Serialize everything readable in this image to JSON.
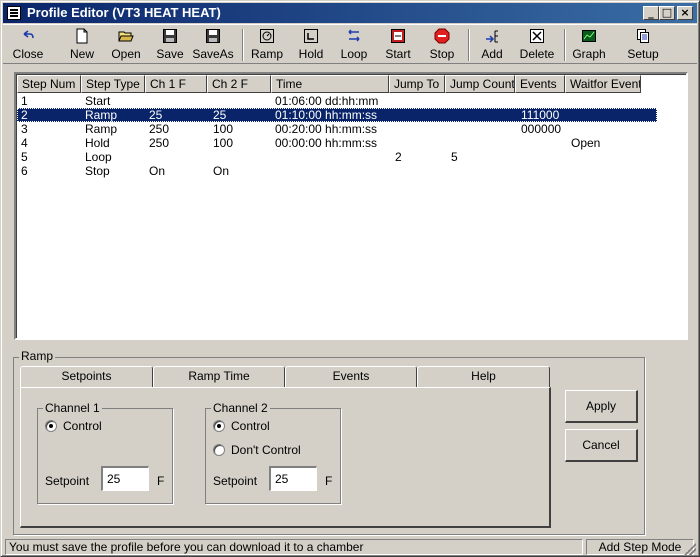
{
  "window": {
    "title": "Profile Editor (VT3 HEAT HEAT)",
    "controls": [
      "_",
      "□",
      "×"
    ]
  },
  "toolbar": [
    {
      "label": "Close",
      "icon": "undo-arrow-icon"
    },
    {
      "label": "New",
      "icon": "new-document-icon"
    },
    {
      "label": "Open",
      "icon": "open-folder-icon"
    },
    {
      "label": "Save",
      "icon": "floppy-disk-icon"
    },
    {
      "label": "SaveAs",
      "icon": "floppy-disk-icon"
    },
    {
      "label": "Ramp",
      "icon": "ramp-icon"
    },
    {
      "label": "Hold",
      "icon": "hold-icon"
    },
    {
      "label": "Loop",
      "icon": "loop-icon"
    },
    {
      "label": "Start",
      "icon": "start-icon"
    },
    {
      "label": "Stop",
      "icon": "stop-sign-icon"
    },
    {
      "label": "Add",
      "icon": "add-step-icon"
    },
    {
      "label": "Delete",
      "icon": "delete-icon"
    },
    {
      "label": "Graph",
      "icon": "graph-icon"
    },
    {
      "label": "Setup",
      "icon": "setup-icon"
    }
  ],
  "table": {
    "columns": [
      "Step Num",
      "Step Type",
      "Ch 1 F",
      "Ch 2 F",
      "Time",
      "Jump To",
      "Jump Count",
      "Events",
      "Waitfor Event"
    ],
    "rows": [
      [
        "1",
        "Start",
        "",
        "",
        "01:06:00 dd:hh:mm",
        "",
        "",
        "",
        ""
      ],
      [
        "2",
        "Ramp",
        "25",
        "25",
        "01:10:00 hh:mm:ss",
        "",
        "",
        "111000",
        ""
      ],
      [
        "3",
        "Ramp",
        "250",
        "100",
        "00:20:00 hh:mm:ss",
        "",
        "",
        "000000",
        ""
      ],
      [
        "4",
        "Hold",
        "250",
        "100",
        "00:00:00 hh:mm:ss",
        "",
        "",
        "",
        "Open"
      ],
      [
        "5",
        "Loop",
        "",
        "",
        "",
        "2",
        "5",
        "",
        ""
      ],
      [
        "6",
        "Stop",
        "On",
        "On",
        "",
        "",
        "",
        "",
        ""
      ]
    ],
    "selected_row": 1
  },
  "editor": {
    "group_label": "Ramp",
    "tabs": [
      "Setpoints",
      "Ramp Time",
      "Events",
      "Help"
    ],
    "channel1": {
      "label": "Channel 1",
      "control_label": "Control",
      "setpoint_label": "Setpoint",
      "setpoint_value": "25",
      "unit": "F"
    },
    "channel2": {
      "label": "Channel 2",
      "control_label": "Control",
      "dont_control_label": "Don't Control",
      "setpoint_label": "Setpoint",
      "setpoint_value": "25",
      "unit": "F"
    },
    "apply_label": "Apply",
    "cancel_label": "Cancel"
  },
  "status": {
    "message": "You must save the profile before you can download it to a chamber",
    "mode": "Add Step Mode"
  },
  "colors": {
    "title_gradient_start": "#0a246a",
    "title_gradient_end": "#3a6ea5",
    "selection": "#0a246a",
    "face": "#d4d0c8"
  }
}
